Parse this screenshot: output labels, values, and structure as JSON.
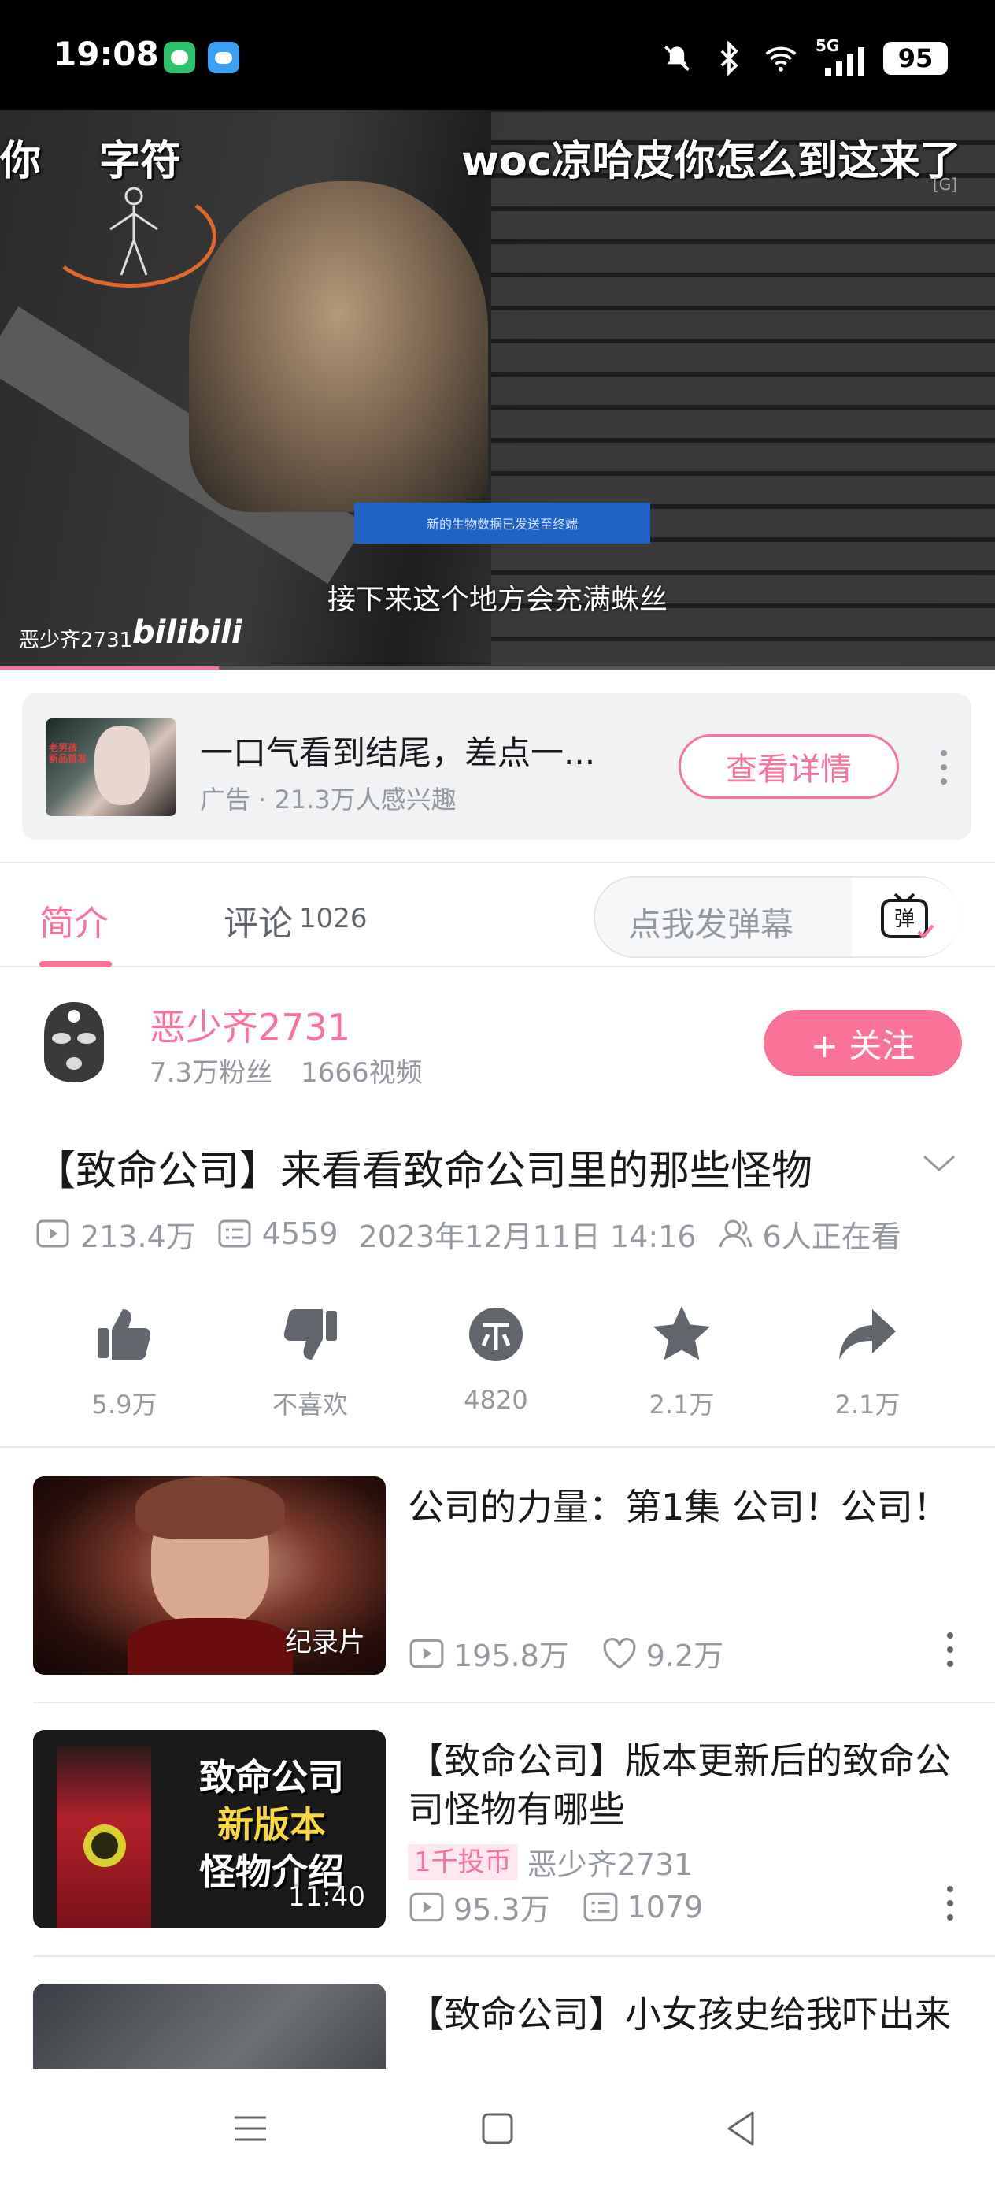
{
  "status_bar": {
    "time": "19:08",
    "network": "5G",
    "battery": "95"
  },
  "video": {
    "danmaku": [
      "你",
      "字符",
      "woc凉哈皮你怎么到这来了"
    ],
    "corner_tag": "[G]",
    "banner_text": "新的生物数据已发送至终端",
    "subtitle": "接下来这个地方会充满蛛丝",
    "watermark_user": "恶少齐2731",
    "watermark_logo": "bilibili",
    "progress": 0.22
  },
  "ad": {
    "title": "一口气看到结尾，差点一...",
    "subtitle": "广告 · 21.3万人感兴趣",
    "button": "查看详情",
    "thumb_text": "老男孩\n新品首发"
  },
  "tabs": {
    "intro": "简介",
    "comments": "评论",
    "comment_count": "1026",
    "danmaku_placeholder": "点我发弹幕",
    "danmaku_button": "弹"
  },
  "uploader": {
    "name": "恶少齐2731",
    "fans": "7.3万粉丝",
    "videos": "1666视频",
    "follow": "+ 关注"
  },
  "video_info": {
    "title": "【致命公司】来看看致命公司里的那些怪物",
    "views": "213.4万",
    "danmaku_count": "4559",
    "date": "2023年12月11日 14:16",
    "watching": "6人正在看"
  },
  "actions": [
    {
      "name": "like",
      "label": "5.9万"
    },
    {
      "name": "dislike",
      "label": "不喜欢"
    },
    {
      "name": "coin",
      "label": "4820"
    },
    {
      "name": "favorite",
      "label": "2.1万"
    },
    {
      "name": "share",
      "label": "2.1万"
    }
  ],
  "recommendations": [
    {
      "title": "公司的力量：第1集 公司！公司！",
      "badge": "纪录片",
      "views": "195.8万",
      "likes": "9.2万"
    },
    {
      "title": "【致命公司】版本更新后的致命公司怪物有哪些",
      "badge": "11:40",
      "coin_tag": "1千投币",
      "author": "恶少齐2731",
      "views": "95.3万",
      "danmaku": "1079",
      "thumb_text": [
        "致命公司",
        "新版本",
        "怪物介绍"
      ]
    },
    {
      "title": "【致命公司】小女孩史给我吓出来"
    }
  ],
  "colors": {
    "accent": "#fb7299",
    "text": "#18191c",
    "muted": "#9499a0"
  }
}
